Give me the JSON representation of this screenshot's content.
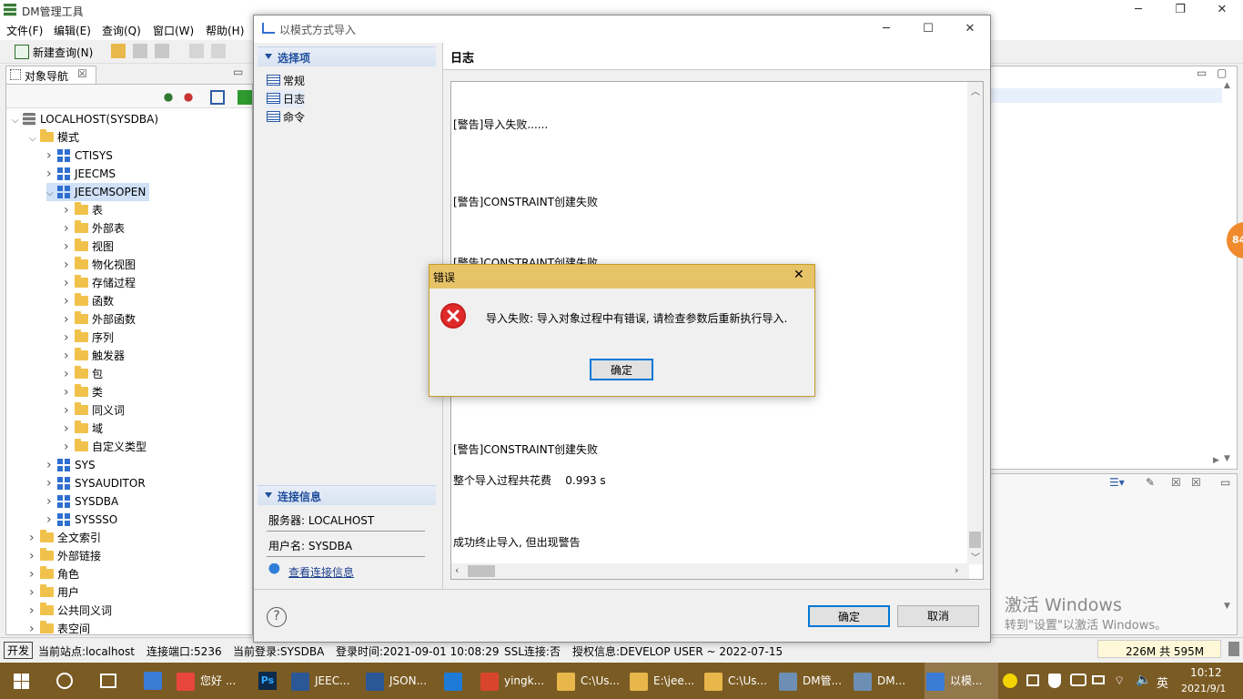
{
  "app": {
    "title": "DM管理工具",
    "menus": [
      "文件(F)",
      "编辑(E)",
      "查询(Q)",
      "窗口(W)",
      "帮助(H)"
    ],
    "toolbar_new_query": "新建查询(N)"
  },
  "navigator": {
    "tab_label": "对象导航",
    "tree": [
      {
        "label": "LOCALHOST(SYSDBA)",
        "level": 0,
        "icon": "database-icon",
        "expanded": true
      },
      {
        "label": "模式",
        "level": 1,
        "icon": "folder-icon",
        "expanded": true
      },
      {
        "label": "CTISYS",
        "level": 2,
        "icon": "schema-icon",
        "expanded": false
      },
      {
        "label": "JEECMS",
        "level": 2,
        "icon": "schema-icon",
        "expanded": false
      },
      {
        "label": "JEECMSOPEN",
        "level": 2,
        "icon": "schema-icon",
        "expanded": true,
        "selected": true
      },
      {
        "label": "表",
        "level": 3,
        "icon": "folder-icon",
        "expanded": false
      },
      {
        "label": "外部表",
        "level": 3,
        "icon": "folder-icon",
        "expanded": false
      },
      {
        "label": "视图",
        "level": 3,
        "icon": "folder-icon",
        "expanded": false
      },
      {
        "label": "物化视图",
        "level": 3,
        "icon": "folder-icon",
        "expanded": false
      },
      {
        "label": "存储过程",
        "level": 3,
        "icon": "folder-icon",
        "expanded": false
      },
      {
        "label": "函数",
        "level": 3,
        "icon": "folder-icon",
        "expanded": false
      },
      {
        "label": "外部函数",
        "level": 3,
        "icon": "folder-icon",
        "expanded": false
      },
      {
        "label": "序列",
        "level": 3,
        "icon": "folder-icon",
        "expanded": false
      },
      {
        "label": "触发器",
        "level": 3,
        "icon": "folder-icon",
        "expanded": false
      },
      {
        "label": "包",
        "level": 3,
        "icon": "folder-icon",
        "expanded": false
      },
      {
        "label": "类",
        "level": 3,
        "icon": "folder-icon",
        "expanded": false
      },
      {
        "label": "同义词",
        "level": 3,
        "icon": "folder-icon",
        "expanded": false
      },
      {
        "label": "域",
        "level": 3,
        "icon": "folder-icon",
        "expanded": false
      },
      {
        "label": "自定义类型",
        "level": 3,
        "icon": "folder-icon",
        "expanded": false
      },
      {
        "label": "SYS",
        "level": 2,
        "icon": "schema-icon",
        "expanded": false
      },
      {
        "label": "SYSAUDITOR",
        "level": 2,
        "icon": "schema-icon",
        "expanded": false
      },
      {
        "label": "SYSDBA",
        "level": 2,
        "icon": "schema-icon",
        "expanded": false
      },
      {
        "label": "SYSSSO",
        "level": 2,
        "icon": "schema-icon",
        "expanded": false
      },
      {
        "label": "全文索引",
        "level": 1,
        "icon": "folder-icon",
        "expanded": false
      },
      {
        "label": "外部链接",
        "level": 1,
        "icon": "folder-icon",
        "expanded": false
      },
      {
        "label": "角色",
        "level": 1,
        "icon": "folder-icon",
        "expanded": false
      },
      {
        "label": "用户",
        "level": 1,
        "icon": "folder-icon",
        "expanded": false
      },
      {
        "label": "公共同义词",
        "level": 1,
        "icon": "folder-icon",
        "expanded": false
      },
      {
        "label": "表空间",
        "level": 1,
        "icon": "folder-icon",
        "expanded": false
      }
    ]
  },
  "import_window": {
    "title": "以模式方式导入",
    "options_header": "选择项",
    "options": [
      "常规",
      "日志",
      "命令"
    ],
    "selected_option": "日志",
    "conn_header": "连接信息",
    "server": "服务器: LOCALHOST",
    "username": "用户名: SYSDBA",
    "view_conn_link": "查看连接信息",
    "log_title": "日志",
    "log_lines": [
      "[警告]导入失败......",
      "[警告]CONSTRAINT创建失败",
      "[警告]CONSTRAINT创建失败",
      "[警告]CONSTRAINT创建失败",
      "整个导入过程共花费    0.993 s",
      "成功终止导入, 但出现警告"
    ],
    "ok_label": "确定",
    "cancel_label": "取消",
    "help_glyph": "?"
  },
  "error_dialog": {
    "title": "错误",
    "message": "导入失败: 导入对象过程中有错误, 请检查参数后重新执行导入.",
    "ok_label": "确定"
  },
  "watermark": {
    "line1": "激活 Windows",
    "line2": "转到\"设置\"以激活 Windows。"
  },
  "badge": "84",
  "status": {
    "mode": "开发",
    "site": "当前站点:localhost",
    "port": "连接端口:5236",
    "login": "当前登录:SYSDBA",
    "login_time": "登录时间:2021-09-01 10:08:29",
    "ssl": "SSL连接:否",
    "license": "授权信息:DEVELOP USER ~ 2022-07-15",
    "memory": "226M 共 595M"
  },
  "taskbar": {
    "items": [
      {
        "label": "您好 ...",
        "color": "#e8463b"
      },
      {
        "label": "",
        "color": "#1f5fbf"
      },
      {
        "label": "JEEC...",
        "color": "#2b5797"
      },
      {
        "label": "JSON...",
        "color": "#2b5797"
      },
      {
        "label": "",
        "color": "#1e7ad6"
      },
      {
        "label": "yingk...",
        "color": "#d9452b"
      },
      {
        "label": "C:\\Us...",
        "color": "#e8b64a"
      },
      {
        "label": "E:\\jee...",
        "color": "#e8b64a"
      },
      {
        "label": "C:\\Us...",
        "color": "#e8b64a"
      },
      {
        "label": "DM管...",
        "color": "#6d8fb5"
      },
      {
        "label": "DM...",
        "color": "#6d8fb5"
      },
      {
        "label": "以模...",
        "color": "#3a7bd5"
      }
    ],
    "ps_label": "Ps",
    "ime": "英",
    "time": "10:12",
    "date": "2021/9/1"
  }
}
